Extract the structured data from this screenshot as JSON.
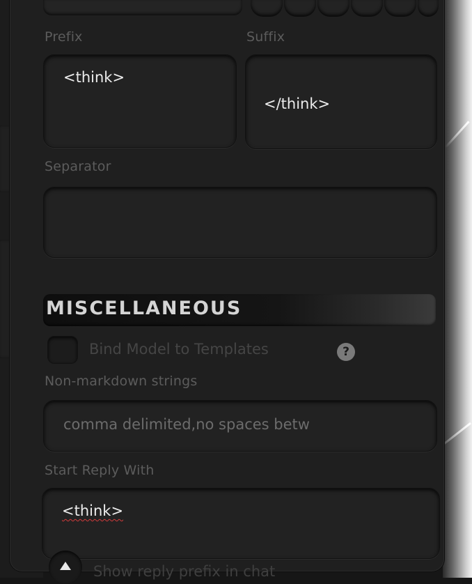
{
  "reasoning": {
    "prefix_label": "Prefix",
    "prefix_value": "<think>",
    "suffix_label": "Suffix",
    "suffix_value": "</think>",
    "separator_label": "Separator",
    "separator_value": ""
  },
  "misc": {
    "section_title": "MISCELLANEOUS",
    "bind_model_label": "Bind Model to Templates",
    "help_glyph": "?",
    "non_markdown_label": "Non-markdown strings",
    "non_markdown_placeholder": "comma delimited,no spaces betw",
    "start_reply_label": "Start Reply With",
    "start_reply_value": "<think>",
    "show_reply_prefix_label": "Show reply prefix in chat"
  },
  "colors": {
    "panel": "#1f1f1f",
    "field": "#222222",
    "label": "#5c5c5c",
    "text": "#ececec",
    "spellcheck": "#d23b3b"
  },
  "icons": {
    "help": "question-circle-icon",
    "toggle": "triangle-up-icon"
  }
}
